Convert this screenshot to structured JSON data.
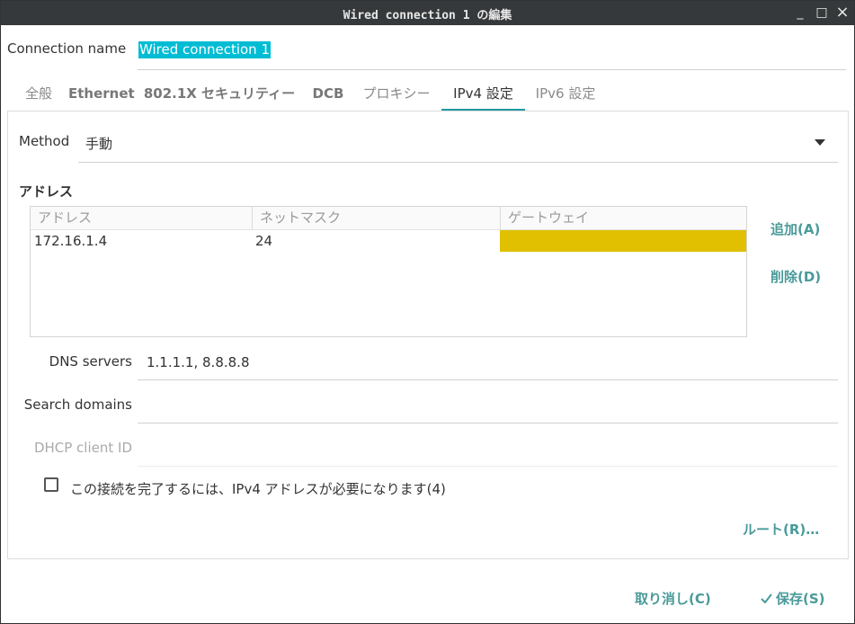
{
  "window": {
    "title": "Wired connection 1 の編集",
    "controls": {
      "minimize": "_",
      "maximize": "□",
      "close": "×"
    }
  },
  "connection_name": {
    "label": "Connection name",
    "value": "Wired connection 1"
  },
  "tabs": [
    {
      "label": "全般"
    },
    {
      "label": "Ethernet"
    },
    {
      "label": "802.1X セキュリティー"
    },
    {
      "label": "DCB"
    },
    {
      "label": "プロキシー"
    },
    {
      "label": "IPv4 設定",
      "active": true
    },
    {
      "label": "IPv6 設定"
    }
  ],
  "method": {
    "label": "Method",
    "value": "手動"
  },
  "addresses": {
    "heading": "アドレス",
    "columns": [
      "アドレス",
      "ネットマスク",
      "ゲートウェイ"
    ],
    "rows": [
      {
        "address": "172.16.1.4",
        "netmask": "24",
        "gateway": ""
      }
    ],
    "add_label": "追加(A)",
    "delete_label": "削除(D)",
    "edit_cell_color": "#e0c000"
  },
  "dns": {
    "label": "DNS servers",
    "value": "1.1.1.1, 8.8.8.8"
  },
  "search_domains": {
    "label": "Search domains",
    "value": ""
  },
  "dhcp_client_id": {
    "label": "DHCP client ID",
    "value": ""
  },
  "require_ipv4": {
    "label": "この接続を完了するには、IPv4 アドレスが必要になります(4)",
    "checked": false
  },
  "routes_label": "ルート(R)…",
  "footer": {
    "cancel_label": "取り消し(C)",
    "save_label": "保存(S)",
    "save_icon": "check-icon"
  },
  "colors": {
    "accent": "#1e9aa0",
    "button_text": "#4a9a9a",
    "selection": "#00bcd4",
    "titlebar": "#36393b"
  }
}
